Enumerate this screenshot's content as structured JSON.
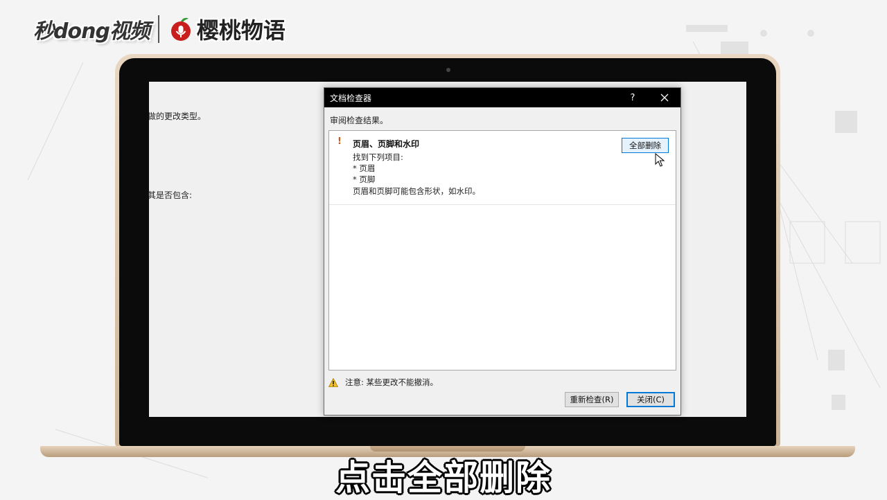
{
  "brand": {
    "miaodong": "秒dong视频",
    "cherry": "樱桃物语"
  },
  "background_doc": {
    "line1": "做的更改类型。",
    "line2": "其是否包含:"
  },
  "dialog": {
    "title": "文档检查器",
    "help": "?",
    "subtitle": "审阅检查结果。",
    "results": [
      {
        "mark": "!",
        "title": "页眉、页脚和水印",
        "lines": [
          "找到下列项目:",
          "* 页眉",
          "* 页脚",
          "页眉和页脚可能包含形状，如水印。"
        ],
        "button": "全部删除"
      }
    ],
    "note": "注意: 某些更改不能撤消。",
    "recheck_button": "重新检查(R)",
    "close_button": "关闭(C)"
  },
  "caption": "点击全部删除",
  "colors": {
    "titlebar": "#000000",
    "accent": "#0078d7",
    "warning": "#c65b10",
    "laptop_frame": "#d8c2a6"
  }
}
